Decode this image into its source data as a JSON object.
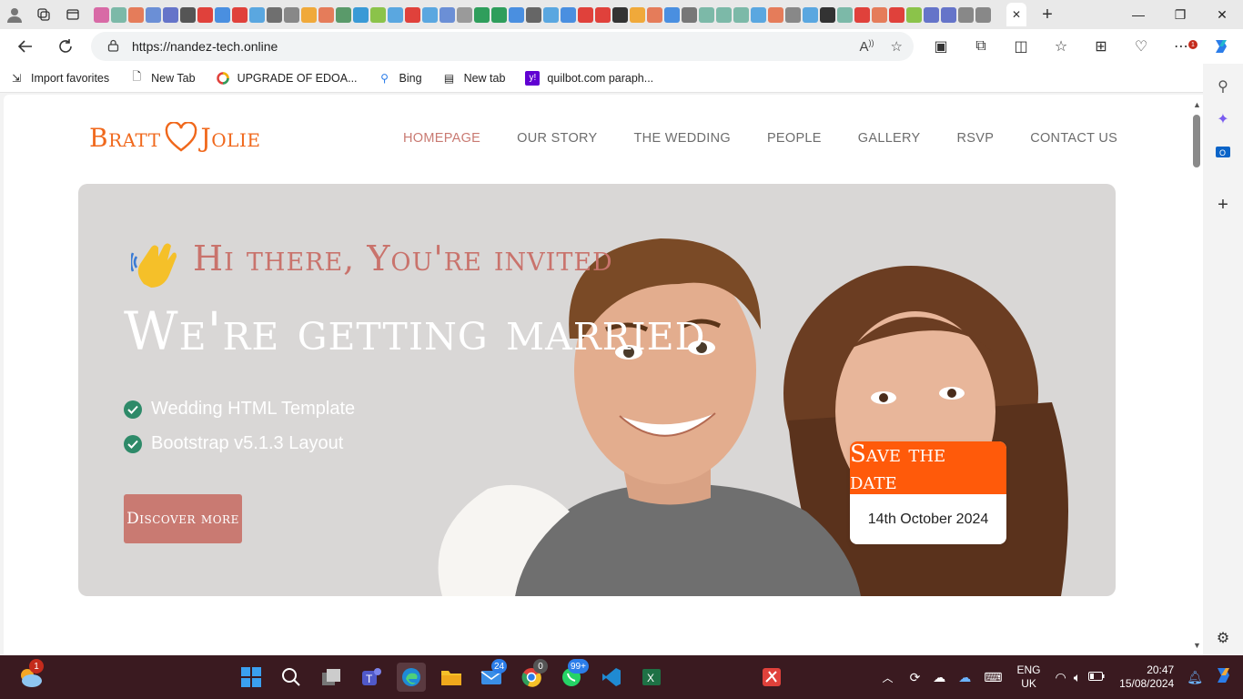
{
  "browser": {
    "address": {
      "url": "https://nandez-tech.online"
    },
    "favorites": [
      {
        "label": "Import favorites",
        "icon": "import-icon"
      },
      {
        "label": "New Tab",
        "icon": "page-icon"
      },
      {
        "label": "UPGRADE OF EDOA...",
        "icon": "google-icon"
      },
      {
        "label": "Bing",
        "icon": "search-icon"
      },
      {
        "label": "New tab",
        "icon": "newtab-icon"
      },
      {
        "label": "quilbot.com paraph...",
        "icon": "yahoo-icon"
      }
    ],
    "tab_colors": [
      "#d86aa6",
      "#7cb9a8",
      "#e57c5a",
      "#6b8fd6",
      "#6574c9",
      "#555",
      "#e0413b",
      "#4a8fe0",
      "#e0413b",
      "#5aa7e0",
      "#6f6f6f",
      "#888",
      "#f0a93a",
      "#e57c5a",
      "#5a9a6a",
      "#3a9ad6",
      "#8bc34a",
      "#5aa7e0",
      "#e0413b",
      "#5aa7e0",
      "#6b8fd6",
      "#9a9a9a",
      "#2f9e5c",
      "#2f9e5c",
      "#4a8fe0",
      "#666",
      "#5aa7e0",
      "#4a8fe0",
      "#e0413b",
      "#e0413b",
      "#333",
      "#f0a93a",
      "#e57c5a",
      "#4a8fe0",
      "#777",
      "#7cb9a8",
      "#7cb9a8",
      "#7cb9a8",
      "#5aa7e0",
      "#e57c5a",
      "#888",
      "#5aa7e0",
      "#333",
      "#7cb9a8",
      "#e0413b",
      "#e57c5a",
      "#e0413b",
      "#8bc34a",
      "#6574c9",
      "#6574c9",
      "#888",
      "#888"
    ]
  },
  "site": {
    "logo_left": "Bratt",
    "logo_right": "Jolie",
    "nav": [
      {
        "label": "HOMEPAGE",
        "active": true
      },
      {
        "label": "OUR STORY",
        "active": false
      },
      {
        "label": "THE WEDDING",
        "active": false
      },
      {
        "label": "PEOPLE",
        "active": false
      },
      {
        "label": "GALLERY",
        "active": false
      },
      {
        "label": "RSVP",
        "active": false
      },
      {
        "label": "CONTACT US",
        "active": false
      }
    ],
    "hero": {
      "greeting": "Hi there, You're invited",
      "headline": "We're getting married",
      "features": [
        "Wedding HTML Template",
        "Bootstrap v5.1.3 Layout"
      ],
      "cta": "Discover more",
      "save_title": "Save the date",
      "save_date": "14th October 2024"
    },
    "colors": {
      "brand": "#f0681c",
      "accent": "#c97a72",
      "save": "#ff5a0a",
      "check": "#2e8a69"
    }
  },
  "taskbar": {
    "weather_badge": "1",
    "mail_badge": "24",
    "chrome_badge": "0",
    "whatsapp_badge": "99+",
    "lang_top": "ENG",
    "lang_bottom": "UK",
    "time": "20:47",
    "date": "15/08/2024"
  }
}
